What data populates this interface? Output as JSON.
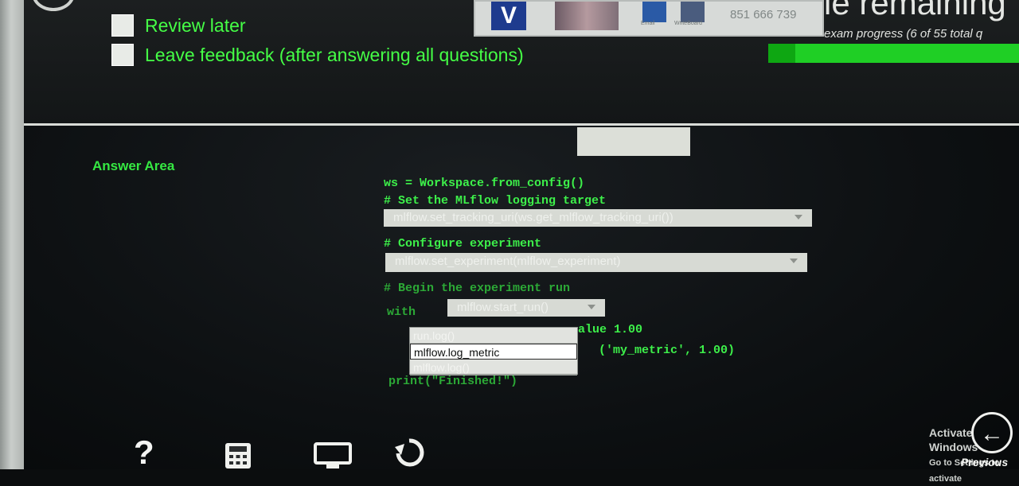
{
  "header": {
    "checkboxes": [
      {
        "label": "Review later"
      },
      {
        "label": "Leave feedback (after answering all questions)"
      }
    ],
    "time_remaining": "ie remaining",
    "progress_label": "exam progress (6 of 55 total q",
    "progress_fraction": 0.1091
  },
  "taskbar": {
    "mail_label": "Email",
    "whiteboard_label": "WriteBoard",
    "phone": "851 666 739"
  },
  "answer_area": {
    "heading": "Answer Area",
    "code_lines": {
      "line1": "ws = Workspace.from_config()",
      "comment1": "# Set the MLflow logging target",
      "comment2": "# Configure experiment",
      "comment3": "# Begin the experiment run",
      "with_kw": "with",
      "value_text": "alue 1.00",
      "args": "('my_metric', 1.00)",
      "print": "print(\"Finished!\")"
    },
    "dropdowns": {
      "tracking_uri": "mlflow.set_tracking_uri(ws.get_mlflow_tracking_uri())",
      "experiment": "mlflow.set_experiment(mlflow_experiment)",
      "start_run": "mlflow.start_run()"
    },
    "listbox_options": [
      "run.log()",
      "mlflow.log_metric",
      "mlflow.log()"
    ],
    "listbox_selected": "mlflow.log_metric"
  },
  "footer": {
    "icons": [
      "help-icon",
      "calculator-icon",
      "monitor-icon",
      "refresh-icon"
    ],
    "help_glyph": "?",
    "activate_title": "Activate Windows",
    "activate_sub": "Go to Settings to activate",
    "previous_label": "Previous"
  },
  "colors": {
    "code_green": "#3df04a",
    "progress_dark": "#0ea712",
    "progress_light": "#1fcf25"
  }
}
